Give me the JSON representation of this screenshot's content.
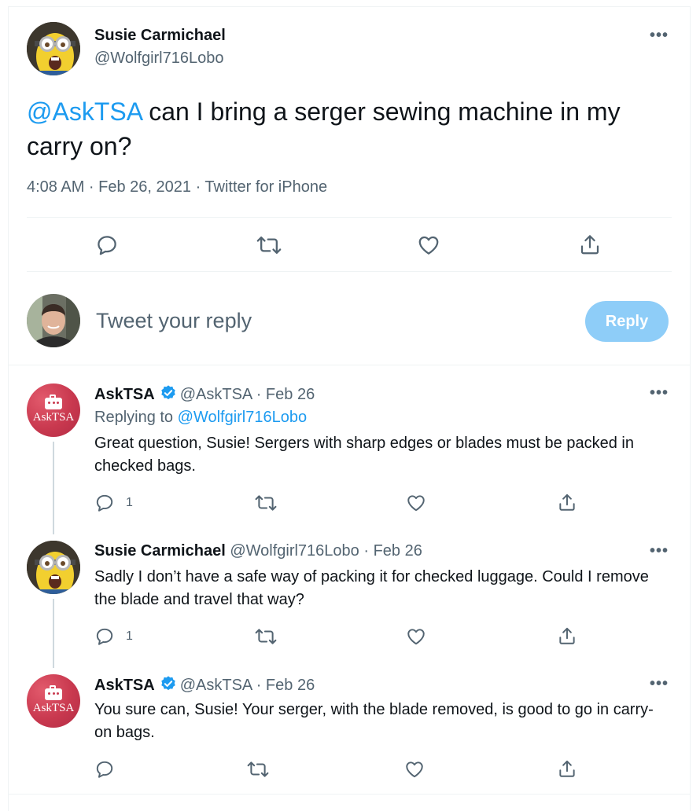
{
  "main_tweet": {
    "author_name": "Susie Carmichael",
    "author_handle": "@Wolfgirl716Lobo",
    "mention": "@AskTSA",
    "text": " can I bring a serger sewing machine in my carry on?",
    "timestamp": "4:08 AM · Feb 26, 2021 · Twitter for iPhone"
  },
  "compose": {
    "placeholder": "Tweet your reply",
    "button_label": "Reply"
  },
  "replies": [
    {
      "author_name": "AskTSA",
      "author_handle": "@AskTSA",
      "date": "· Feb 26",
      "avatar_text": "AskTSA",
      "replying_prefix": "Replying to ",
      "replying_handle": "@Wolfgirl716Lobo",
      "text": "Great question, Susie! Sergers with sharp edges or blades must be packed in checked bags.",
      "reply_count": "1"
    },
    {
      "author_name": "Susie Carmichael",
      "author_handle": "@Wolfgirl716Lobo",
      "date": "· Feb 26",
      "text": "Sadly I don’t have a safe way of packing it for checked luggage. Could I remove the blade and travel that way?",
      "reply_count": "1"
    },
    {
      "author_name": "AskTSA",
      "author_handle": "@AskTSA",
      "date": "· Feb 26",
      "avatar_text": "AskTSA",
      "text": "You sure can, Susie! Your serger, with the blade removed, is good to go in carry-on bags."
    }
  ],
  "more_label": "•••",
  "colors": {
    "accent": "#1d9bf0",
    "muted": "#536471",
    "reply_button": "#8ecdf8",
    "tsa_avatar": "#c9394f"
  }
}
